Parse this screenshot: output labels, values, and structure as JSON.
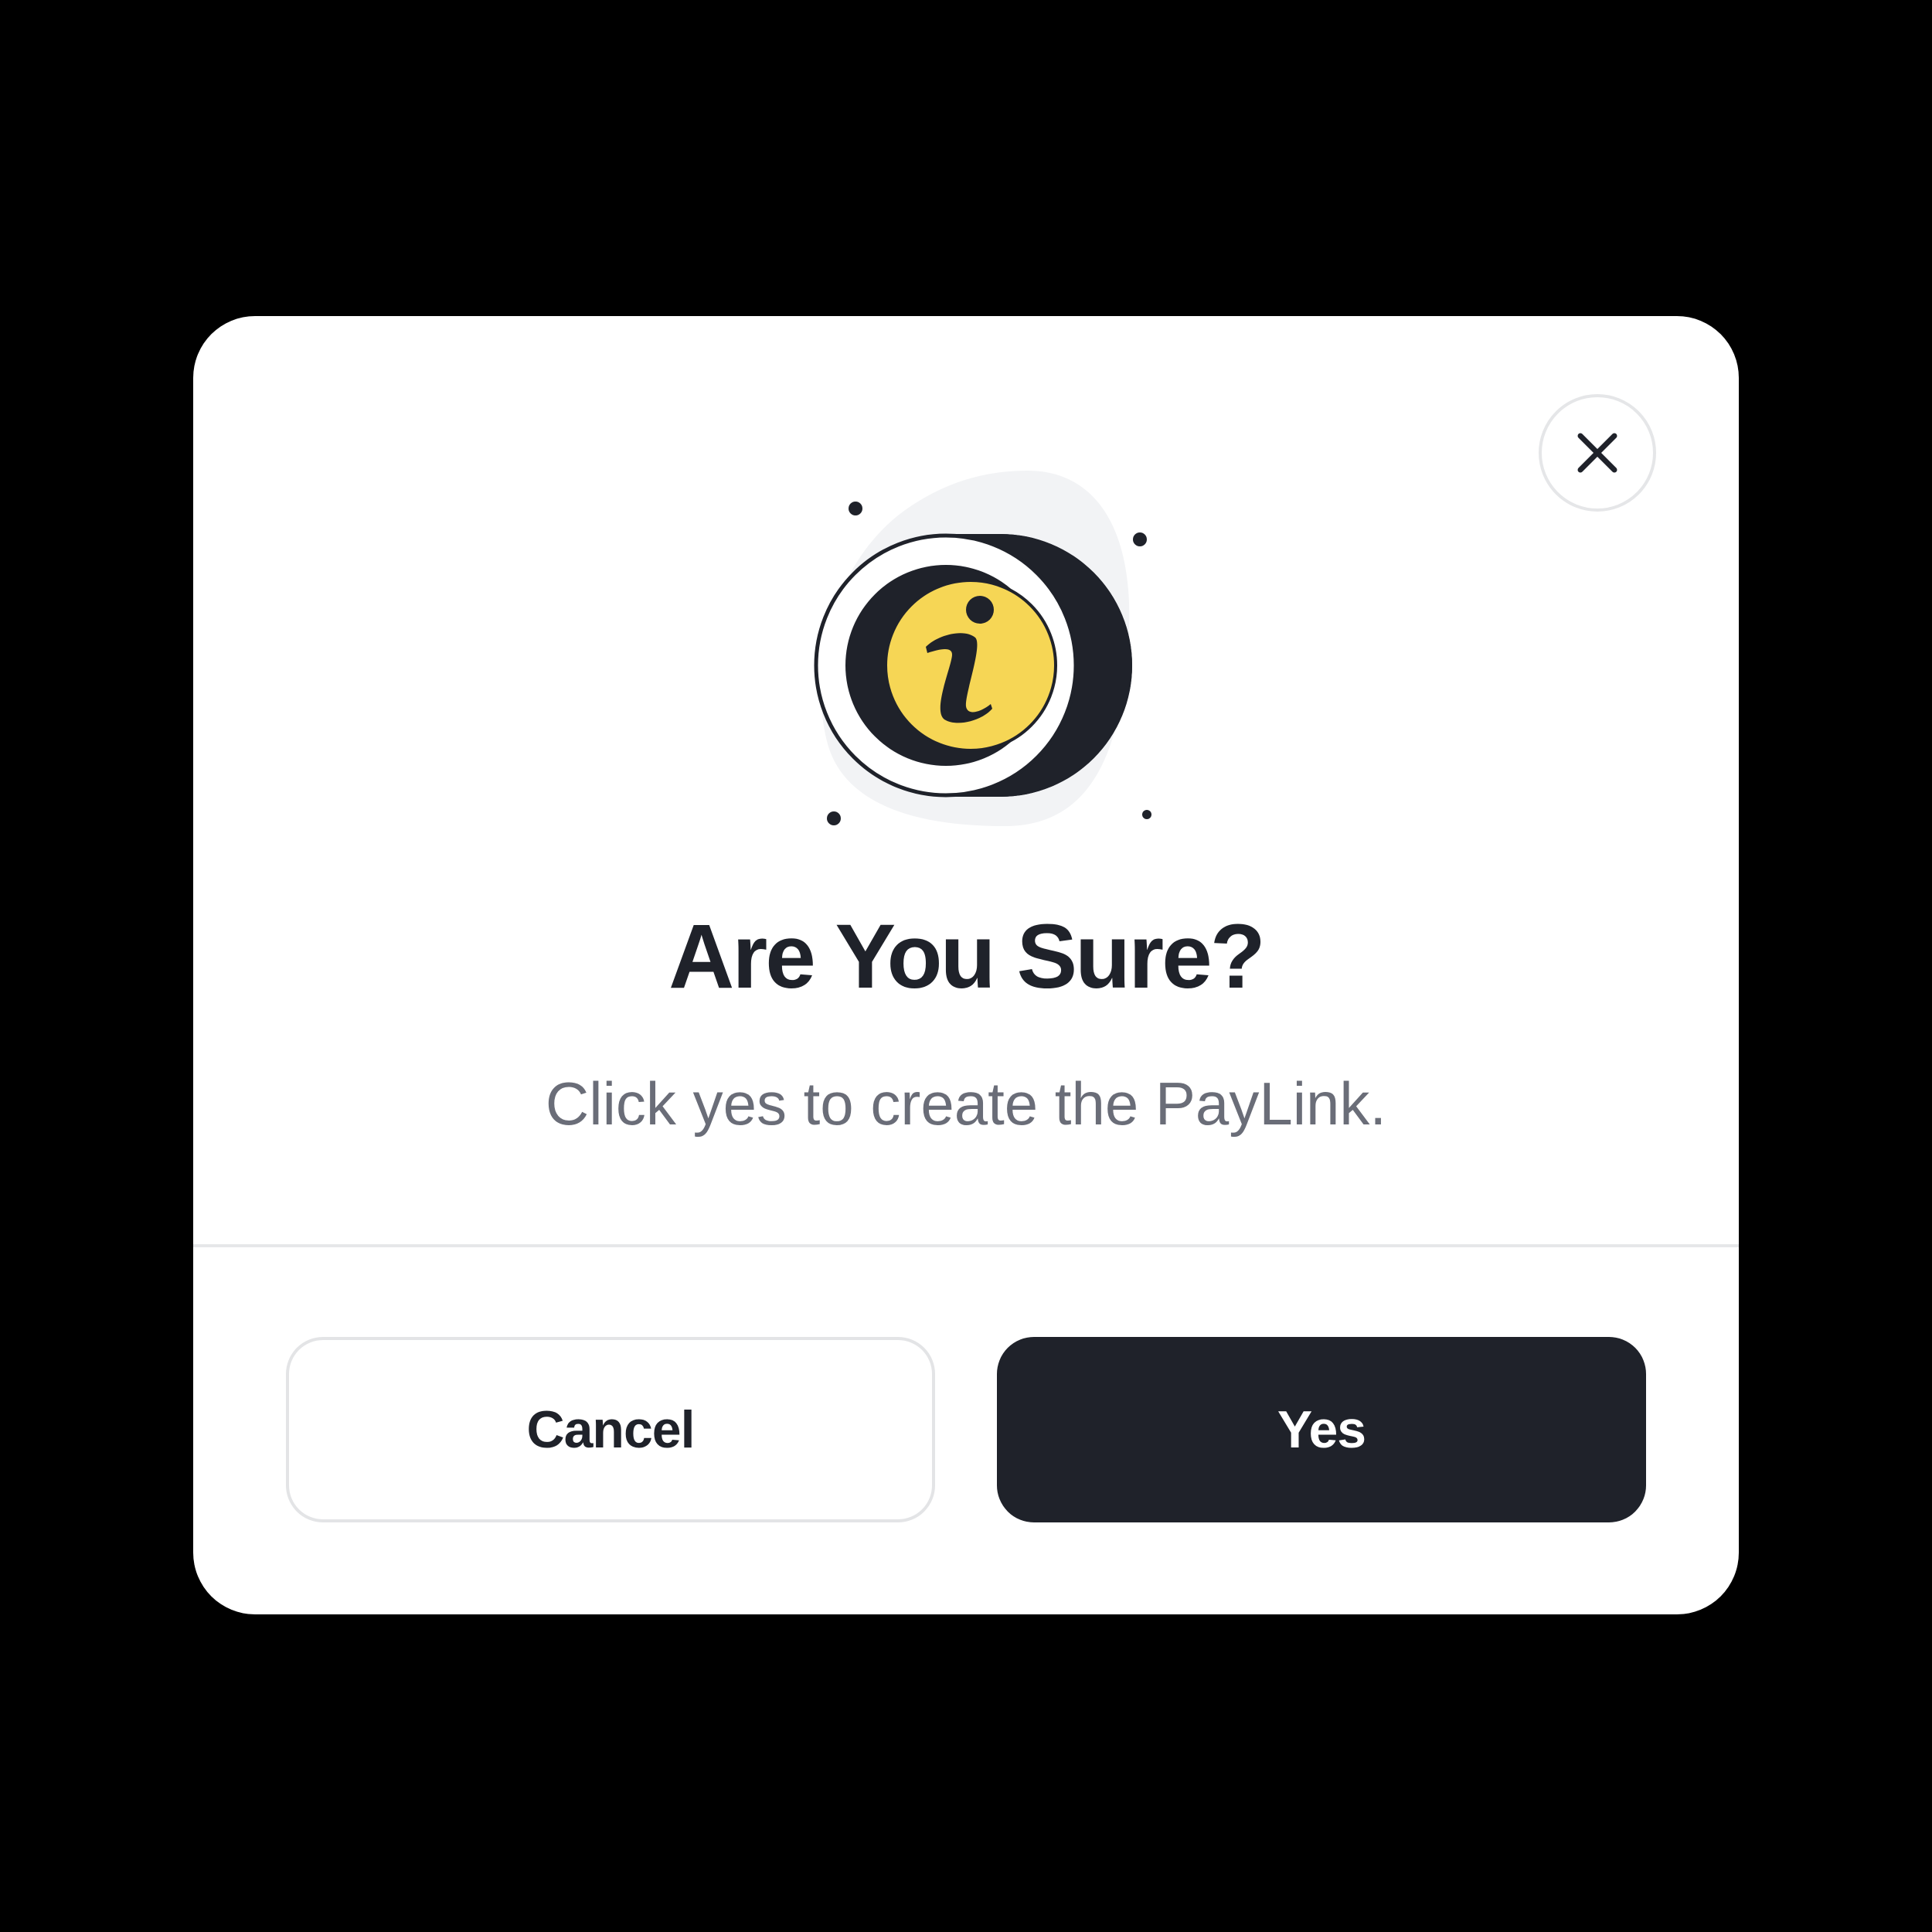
{
  "dialog": {
    "title": "Are You Sure?",
    "message": "Click yes to create the PayLink.",
    "close_icon": "close-icon",
    "illustration_icon": "info-icon",
    "buttons": {
      "cancel_label": "Cancel",
      "confirm_label": "Yes"
    }
  },
  "colors": {
    "backdrop": "#000000",
    "dialog_background": "#ffffff",
    "primary_button": "#1f222a",
    "accent_yellow": "#f6d655",
    "text_primary": "#1f222a",
    "text_secondary": "#6a6d78",
    "border": "#e3e4e6"
  }
}
